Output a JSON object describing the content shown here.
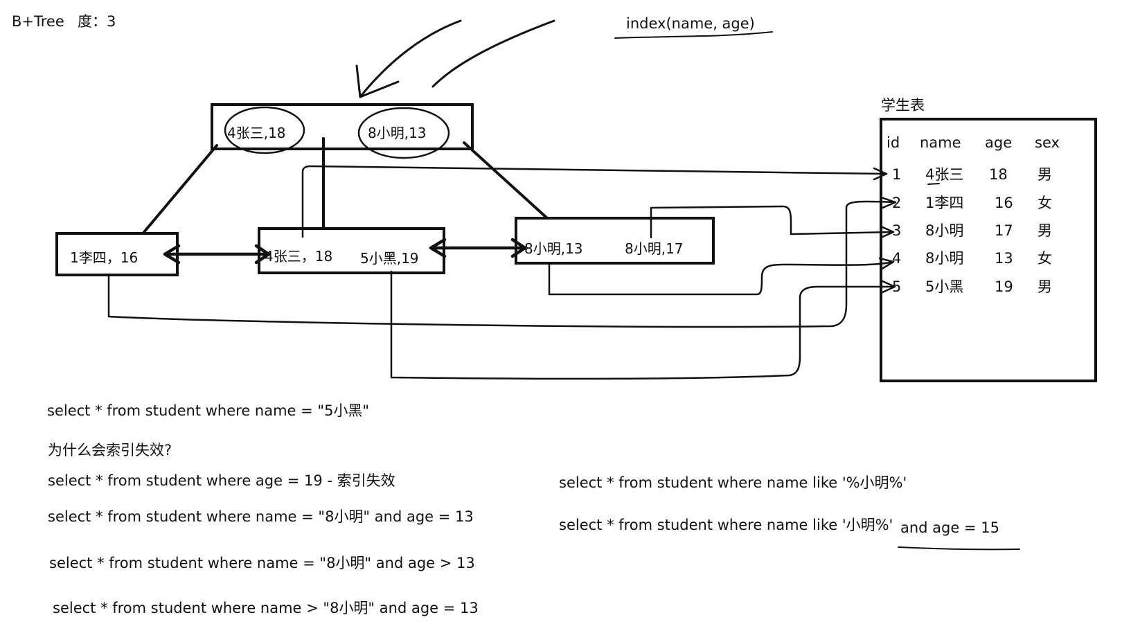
{
  "header": {
    "title": "B+Tree",
    "degree": "度：3",
    "index_label": "index(name, age)"
  },
  "tree": {
    "root": {
      "key1": "4张三,18",
      "key2": "8小明,13"
    },
    "leaf1": {
      "key1": "1李四，16"
    },
    "leaf2": {
      "key1": "4张三，18",
      "key2": "5小黑,19"
    },
    "leaf3": {
      "key1": "8小明,13",
      "key2": "8小明,17"
    }
  },
  "table": {
    "title": "学生表",
    "columns": [
      "id",
      "name",
      "age",
      "sex"
    ],
    "rows": [
      [
        "1",
        "4张三",
        "18",
        "男"
      ],
      [
        "2",
        "1李四",
        "16",
        "女"
      ],
      [
        "3",
        "8小明",
        "17",
        "男"
      ],
      [
        "4",
        "8小明",
        "13",
        "女"
      ],
      [
        "5",
        "5小黑",
        "19",
        "男"
      ]
    ]
  },
  "queries": {
    "q1": "select * from student where name = \"5小黑\"",
    "question": "为什么会索引失效?",
    "q2": "select * from student where age = 19  - 索引失效",
    "q3": "select * from student where name = \"8小明\" and age = 13",
    "q4": "select * from student where name = \"8小明\" and age > 13",
    "q5": "select * from student where name > \"8小明\" and age = 13",
    "q6": "select * from student where name like '%小明%'",
    "q7a": "select * from student where name like '小明%'",
    "q7b": "and age = 15"
  }
}
